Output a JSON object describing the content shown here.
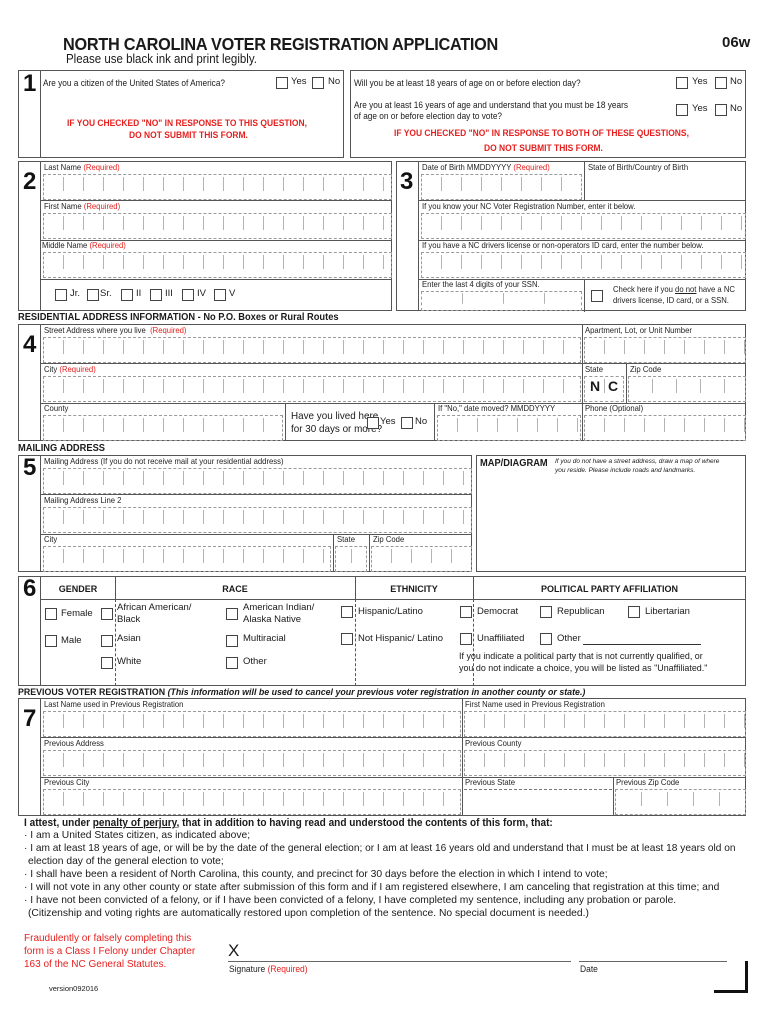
{
  "header": {
    "title": "NORTH CAROLINA VOTER REGISTRATION APPLICATION",
    "form_code": "06w",
    "subtitle": "Please use black ink and print legibly."
  },
  "section1": {
    "number": "1",
    "citizen_question": "Are you a citizen of the United States of America?",
    "yes": "Yes",
    "no": "No",
    "warning_line1": "IF YOU CHECKED \"NO\" IN  RESPONSE TO THIS QUESTION,",
    "warning_line2": "DO NOT SUBMIT THIS FORM."
  },
  "age": {
    "q1": "Will you be at least 18 years of age on or before election day?",
    "q2_line1": "Are you at least 16 years of age and understand that you must be 18 years",
    "q2_line2": "of age on or before election day to vote?",
    "yes": "Yes",
    "no": "No",
    "warning_line1": "IF YOU CHECKED \"NO\" IN  RESPONSE TO BOTH OF THESE QUESTIONS,",
    "warning_line2": "DO NOT SUBMIT THIS FORM."
  },
  "section2": {
    "number": "2",
    "last_name": "Last Name",
    "first_name": "First Name",
    "middle_name": "Middle Name",
    "required": "(Required)",
    "suffixes": [
      "Jr.",
      "Sr.",
      "II",
      "III",
      "IV",
      "V"
    ]
  },
  "section3": {
    "number": "3",
    "dob": "Date of Birth MMDDYYYY",
    "required": "(Required)",
    "birth_place": "State of Birth/Country of Birth",
    "voter_reg": "If you know your NC Voter Registration Number, enter it below.",
    "drivers_license": "If you have a NC drivers license or non-operators ID card, enter the number below.",
    "ssn": "Enter the last 4 digits of your SSN.",
    "no_id_line1_pre": "Check here if you ",
    "no_id_line1_u": "do not",
    "no_id_line1_post": " have a NC",
    "no_id_line2": "drivers license, ID card, or a SSN."
  },
  "residential": {
    "heading": "RESIDENTIAL ADDRESS INFORMATION - No P.O. Boxes or Rural Routes",
    "number": "4",
    "street": "Street Address where you live",
    "required": "(Required)",
    "apartment": "Apartment, Lot, or Unit Number",
    "city": "City",
    "state": "State",
    "state_value_1": "N",
    "state_value_2": "C",
    "zip": "Zip Code",
    "county": "County",
    "lived_q_line1": "Have you lived here",
    "lived_q_line2": "for 30 days or more?",
    "yes": "Yes",
    "no": "No",
    "date_moved": "If \"No,\" date moved? MMDDYYYY",
    "phone": "Phone (Optional)"
  },
  "mailing": {
    "heading": "MAILING ADDRESS",
    "number": "5",
    "address": "Mailing Address (If you do not receive mail at your residential address)",
    "line2": "Mailing Address Line 2",
    "city": "City",
    "state": "State",
    "zip": "Zip Code",
    "map_title": "MAP/DIAGRAM",
    "map_note_line1": "If you do not have a street address, draw  a map of where",
    "map_note_line2": "you reside.  Please include roads and landmarks."
  },
  "section6": {
    "number": "6",
    "gender_head": "GENDER",
    "race_head": "RACE",
    "ethnicity_head": "ETHNICITY",
    "party_head": "POLITICAL PARTY AFFILIATION",
    "gender": [
      "Female",
      "Male"
    ],
    "race": {
      "african_american_1": "African American/",
      "african_american_2": "Black",
      "american_indian_1": "American Indian/",
      "american_indian_2": "Alaska Native",
      "asian": "Asian",
      "multiracial": "Multiracial",
      "white": "White",
      "other": "Other"
    },
    "ethnicity": [
      "Hispanic/Latino",
      "Not Hispanic/ Latino"
    ],
    "party": [
      "Democrat",
      "Republican",
      "Libertarian",
      "Unaffiliated",
      "Other"
    ],
    "party_note_line1": "If you indicate a political party that is not currently qualified, or",
    "party_note_line2": "you do not indicate a choice, you will be listed as \"Unaffiliated.\""
  },
  "previous": {
    "heading": "PREVIOUS VOTER REGISTRATION",
    "heading_note": "(This information will be used to cancel your previous voter registration in another county or state.)",
    "number": "7",
    "last_name": "Last Name used in Previous Registration",
    "first_name": "First Name used in Previous Registration",
    "address": "Previous Address",
    "county": "Previous County",
    "city": "Previous City",
    "state": "Previous State",
    "zip": "Previous Zip Code"
  },
  "attestation": {
    "intro_pre": "I attest, under ",
    "intro_u": "penalty of perjury",
    "intro_post": ", that in addition to having read and understood the contents of this form, that:",
    "items": [
      "· I am a United States citizen, as indicated above;",
      "· I am at least 18 years of age, or will be by the date of the general election; or I am at least 16 years old and understand that I must be at least 18 years old on",
      "  election day of the general election to vote;",
      "· I shall have been a resident of North Carolina, this county, and precinct for 30 days before the election in which I intend to vote;",
      "· I will not vote in any other county or state after submission of this form and if I am registered elsewhere, I am canceling that registration at this time;  and",
      "· I have not been convicted of a felony, or if I have been convicted of a felony, I have completed my sentence, including any probation or parole.",
      "  (Citizenship and voting rights are automatically restored upon completion of the sentence. No special document is needed.)"
    ]
  },
  "footer": {
    "fraud_line1": "Fraudulently  or  falsely  completing  this",
    "fraud_line2": "form is a Class I Felony under Chapter",
    "fraud_line3": "163 of the NC General Statutes.",
    "version": "version092016",
    "sig_x": "X",
    "signature": "Signature",
    "required": "(Required)",
    "date": "Date"
  }
}
